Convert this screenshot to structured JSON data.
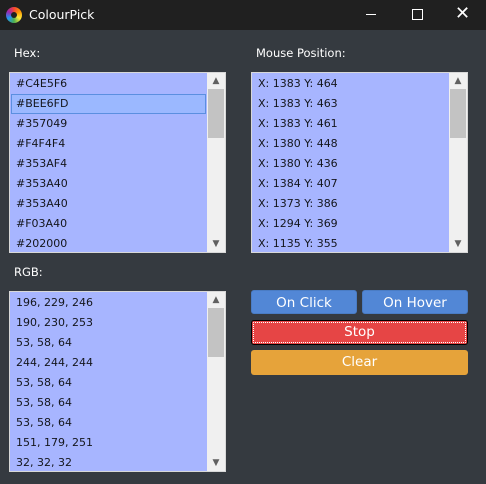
{
  "window": {
    "title": "ColourPick",
    "minimize_glyph": "",
    "close_glyph": "✕"
  },
  "hex": {
    "label": "Hex:",
    "items": [
      "#C4E5F6",
      "#BEE6FD",
      "#357049",
      "#F4F4F4",
      "#353AF4",
      "#353A40",
      "#353A40",
      "#F03A40",
      "#202000"
    ],
    "selected_index": 1
  },
  "mouse": {
    "label": "Mouse Position:",
    "items": [
      "X: 1383 Y: 464",
      "X: 1383 Y: 463",
      "X: 1383 Y: 461",
      "X: 1380 Y: 448",
      "X: 1380 Y: 436",
      "X: 1384 Y: 407",
      "X: 1373 Y: 386",
      "X: 1294 Y: 369",
      "X: 1135 Y: 355"
    ]
  },
  "rgb": {
    "label": "RGB:",
    "items": [
      "196, 229, 246",
      "190, 230, 253",
      "53, 58, 64",
      "244, 244, 244",
      "53, 58, 64",
      "53, 58, 64",
      "53, 58, 64",
      "151, 179, 251",
      "32, 32, 32"
    ]
  },
  "buttons": {
    "on_click": "On Click",
    "on_hover": "On Hover",
    "stop": "Stop",
    "clear": "Clear"
  },
  "colors": {
    "background": "#353a40",
    "list_background": "#a7b5ff",
    "title_bar": "#202020",
    "on_click": "#5287d6",
    "on_hover": "#5287d6",
    "stop": "#e64545",
    "clear": "#e6a33a"
  },
  "icons": {
    "app": "colour-wheel-icon",
    "minimize": "minimize-icon",
    "maximize": "maximize-icon",
    "close": "close-icon",
    "scroll_up": "chevron-up-icon",
    "scroll_down": "chevron-down-icon"
  }
}
